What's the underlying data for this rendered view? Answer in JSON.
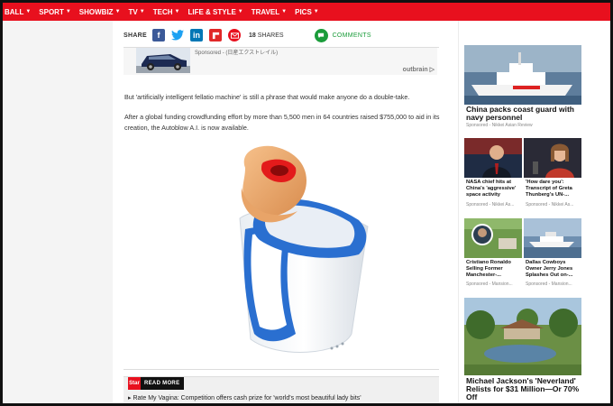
{
  "nav": {
    "items": [
      {
        "label": "BALL"
      },
      {
        "label": "SPORT"
      },
      {
        "label": "SHOWBIZ"
      },
      {
        "label": "TV"
      },
      {
        "label": "TECH"
      },
      {
        "label": "LIFE & STYLE"
      },
      {
        "label": "TRAVEL"
      },
      {
        "label": "PICS"
      }
    ]
  },
  "share": {
    "label": "SHARE",
    "count": "18",
    "count_label": "SHARES",
    "comments_label": "COMMENTS",
    "colors": {
      "facebook": "#3b5998",
      "twitter": "#1da1f2",
      "linkedin": "#0077b5",
      "flipboard": "#e12828",
      "email": "#e8101e",
      "comments": "#1a9c3a"
    }
  },
  "ad": {
    "sponsor_text": "Sponsored - (日産エクストレイル)",
    "provider": "outbrain"
  },
  "article": {
    "para1": "But 'artificially intelligent fellatio machine' is still a phrase that would make anyone do a double-take.",
    "para2": "After a global funding crowdfunding effort by more than 5,500 men in 64 countries raised $755,000 to aid in its creation, the Autoblow A.I. is now available."
  },
  "read_more": {
    "label": "READ MORE",
    "link": "Rate My Vagina: Competition offers cash prize for 'world's most beautiful lady bits'"
  },
  "sidebar": {
    "main": {
      "title": "China packs coast guard with navy personnel",
      "sponsor": "Sponsored - Nikkei Asian Review"
    },
    "grid": [
      {
        "title": "NASA chief hits at China's 'aggressive' space activity",
        "sponsor": "Sponsored - Nikkei As..."
      },
      {
        "title": "'How dare you': Transcript of Greta Thunberg's UN-...",
        "sponsor": "Sponsored - Nikkei As..."
      },
      {
        "title": "Cristiano Ronaldo Selling Former Manchester-...",
        "sponsor": "Sponsored - Mansion..."
      },
      {
        "title": "Dallas Cowboys Owner Jerry Jones Splashes Out on-...",
        "sponsor": "Sponsored - Mansion..."
      }
    ],
    "bottom": {
      "title": "Michael Jackson's 'Neverland' Relists for $31 Million—Or 70% Off"
    }
  }
}
